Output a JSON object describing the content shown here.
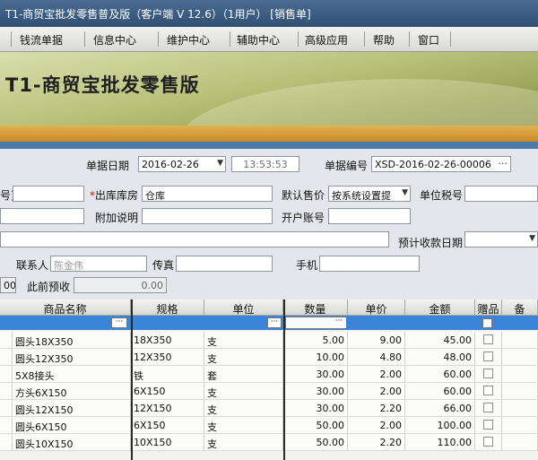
{
  "window": {
    "title": "T1-商贸宝批发零售普及版（客户端 V 12.6）（1用户） [销售单]"
  },
  "menu": [
    {
      "label": "钱流单据"
    },
    {
      "label": "信息中心"
    },
    {
      "label": "维护中心"
    },
    {
      "label": "辅助中心"
    },
    {
      "label": "高级应用"
    },
    {
      "label": "帮助"
    },
    {
      "label": "窗口"
    }
  ],
  "banner": {
    "title": "T1-商贸宝批发零售版"
  },
  "form": {
    "date_label": "单据日期",
    "date_value": "2016-02-26",
    "time_value": "13:53:53",
    "docno_label": "单据编号",
    "docno_value": "XSD-2016-02-26-00006",
    "left_clipped_label": "号)",
    "warehouse_label": "出库库房",
    "warehouse_value": "仓库",
    "default_price_label": "默认售价",
    "default_price_value": "按系统设置提",
    "tax_no_label": "单位税号",
    "extra_note_label": "附加说明",
    "bank_account_label": "开户账号",
    "expected_date_label": "预计收款日期",
    "contact_label": "联系人",
    "contact_value": "陈金伟",
    "fax_label": "传真",
    "mobile_label": "手机",
    "prior_receipt_label": "此前预收",
    "prior_receipt_value": "0.00",
    "left_clipped_value": "00"
  },
  "grid": {
    "columns": [
      "商品名称",
      "规格",
      "单位",
      "数量",
      "单价",
      "金额",
      "赠品",
      "备"
    ],
    "rows": [
      {
        "name": "圆头18X350",
        "spec": "18X350",
        "unit": "支",
        "qty": "5.00",
        "price": "9.00",
        "amount": "45.00"
      },
      {
        "name": "圆头12X350",
        "spec": "12X350",
        "unit": "支",
        "qty": "10.00",
        "price": "4.80",
        "amount": "48.00"
      },
      {
        "name": "5X8接头",
        "spec": "铁",
        "unit": "套",
        "qty": "30.00",
        "price": "2.00",
        "amount": "60.00"
      },
      {
        "name": "方头6X150",
        "spec": "6X150",
        "unit": "支",
        "qty": "30.00",
        "price": "2.00",
        "amount": "60.00"
      },
      {
        "name": "圆头12X150",
        "spec": "12X150",
        "unit": "支",
        "qty": "30.00",
        "price": "2.20",
        "amount": "66.00"
      },
      {
        "name": "圆头6X150",
        "spec": "6X150",
        "unit": "支",
        "qty": "50.00",
        "price": "2.00",
        "amount": "100.00"
      },
      {
        "name": "圆头10X150",
        "spec": "10X150",
        "unit": "支",
        "qty": "50.00",
        "price": "2.20",
        "amount": "110.00"
      }
    ]
  }
}
